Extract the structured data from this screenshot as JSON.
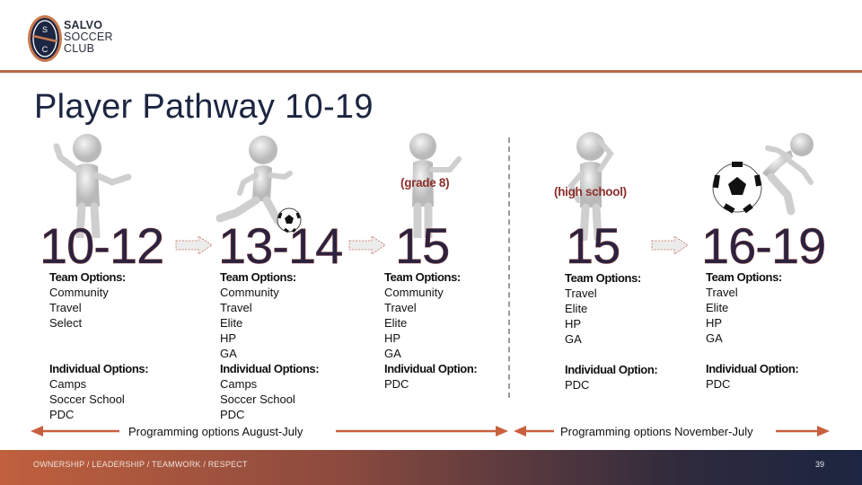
{
  "header": {
    "logo_initials": [
      "S",
      "C"
    ],
    "brand_lines": [
      "SALVO",
      "SOCCER",
      "CLUB"
    ]
  },
  "title": "Player Pathway 10-19",
  "stages": [
    {
      "age": "10-12",
      "note": "",
      "team_heading": "Team Options:",
      "team_options": [
        "Community",
        "Travel",
        "Select"
      ],
      "individual_heading": "Individual Options:",
      "individual_options": [
        "Camps",
        "Soccer School",
        "PDC"
      ]
    },
    {
      "age": "13-14",
      "note": "",
      "team_heading": "Team Options:",
      "team_options": [
        "Community",
        "Travel",
        "Elite",
        "HP",
        "GA"
      ],
      "individual_heading": "Individual Options:",
      "individual_options": [
        "Camps",
        "Soccer School",
        "PDC"
      ]
    },
    {
      "age": "15",
      "note": "(grade 8)",
      "team_heading": "Team Options:",
      "team_options": [
        "Community",
        "Travel",
        "Elite",
        "HP",
        "GA"
      ],
      "individual_heading": "Individual Option:",
      "individual_options": [
        "PDC"
      ]
    },
    {
      "age": "15",
      "note": "(high school)",
      "team_heading": "Team Options:",
      "team_options": [
        "Travel",
        "Elite",
        "HP",
        "GA"
      ],
      "individual_heading": "Individual Option:",
      "individual_options": [
        "PDC"
      ]
    },
    {
      "age": "16-19",
      "note": "",
      "team_heading": "Team Options:",
      "team_options": [
        "Travel",
        "Elite",
        "HP",
        "GA"
      ],
      "individual_heading": "Individual Option:",
      "individual_options": [
        "PDC"
      ]
    }
  ],
  "programming": {
    "left_label": "Programming  options August-July",
    "right_label": "Programming options November-July"
  },
  "footer": {
    "values": "OWNERSHIP / LEADERSHIP / TEAMWORK / RESPECT",
    "page_number": "39"
  },
  "colors": {
    "accent": "#c0603e",
    "navy": "#1c2541",
    "note_red": "#8c2f2a"
  }
}
